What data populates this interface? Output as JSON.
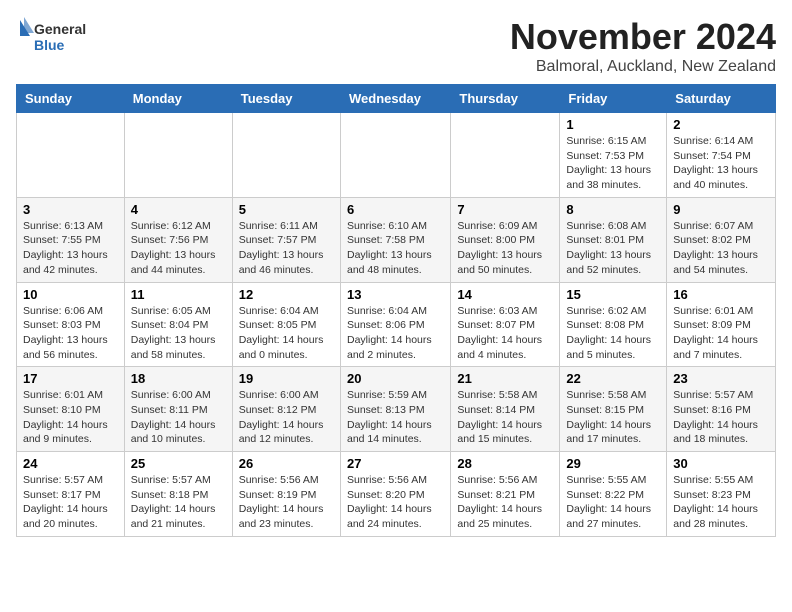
{
  "logo": {
    "general": "General",
    "blue": "Blue"
  },
  "header": {
    "title": "November 2024",
    "subtitle": "Balmoral, Auckland, New Zealand"
  },
  "weekdays": [
    "Sunday",
    "Monday",
    "Tuesday",
    "Wednesday",
    "Thursday",
    "Friday",
    "Saturday"
  ],
  "weeks": [
    [
      {
        "day": "",
        "info": ""
      },
      {
        "day": "",
        "info": ""
      },
      {
        "day": "",
        "info": ""
      },
      {
        "day": "",
        "info": ""
      },
      {
        "day": "",
        "info": ""
      },
      {
        "day": "1",
        "info": "Sunrise: 6:15 AM\nSunset: 7:53 PM\nDaylight: 13 hours and 38 minutes."
      },
      {
        "day": "2",
        "info": "Sunrise: 6:14 AM\nSunset: 7:54 PM\nDaylight: 13 hours and 40 minutes."
      }
    ],
    [
      {
        "day": "3",
        "info": "Sunrise: 6:13 AM\nSunset: 7:55 PM\nDaylight: 13 hours and 42 minutes."
      },
      {
        "day": "4",
        "info": "Sunrise: 6:12 AM\nSunset: 7:56 PM\nDaylight: 13 hours and 44 minutes."
      },
      {
        "day": "5",
        "info": "Sunrise: 6:11 AM\nSunset: 7:57 PM\nDaylight: 13 hours and 46 minutes."
      },
      {
        "day": "6",
        "info": "Sunrise: 6:10 AM\nSunset: 7:58 PM\nDaylight: 13 hours and 48 minutes."
      },
      {
        "day": "7",
        "info": "Sunrise: 6:09 AM\nSunset: 8:00 PM\nDaylight: 13 hours and 50 minutes."
      },
      {
        "day": "8",
        "info": "Sunrise: 6:08 AM\nSunset: 8:01 PM\nDaylight: 13 hours and 52 minutes."
      },
      {
        "day": "9",
        "info": "Sunrise: 6:07 AM\nSunset: 8:02 PM\nDaylight: 13 hours and 54 minutes."
      }
    ],
    [
      {
        "day": "10",
        "info": "Sunrise: 6:06 AM\nSunset: 8:03 PM\nDaylight: 13 hours and 56 minutes."
      },
      {
        "day": "11",
        "info": "Sunrise: 6:05 AM\nSunset: 8:04 PM\nDaylight: 13 hours and 58 minutes."
      },
      {
        "day": "12",
        "info": "Sunrise: 6:04 AM\nSunset: 8:05 PM\nDaylight: 14 hours and 0 minutes."
      },
      {
        "day": "13",
        "info": "Sunrise: 6:04 AM\nSunset: 8:06 PM\nDaylight: 14 hours and 2 minutes."
      },
      {
        "day": "14",
        "info": "Sunrise: 6:03 AM\nSunset: 8:07 PM\nDaylight: 14 hours and 4 minutes."
      },
      {
        "day": "15",
        "info": "Sunrise: 6:02 AM\nSunset: 8:08 PM\nDaylight: 14 hours and 5 minutes."
      },
      {
        "day": "16",
        "info": "Sunrise: 6:01 AM\nSunset: 8:09 PM\nDaylight: 14 hours and 7 minutes."
      }
    ],
    [
      {
        "day": "17",
        "info": "Sunrise: 6:01 AM\nSunset: 8:10 PM\nDaylight: 14 hours and 9 minutes."
      },
      {
        "day": "18",
        "info": "Sunrise: 6:00 AM\nSunset: 8:11 PM\nDaylight: 14 hours and 10 minutes."
      },
      {
        "day": "19",
        "info": "Sunrise: 6:00 AM\nSunset: 8:12 PM\nDaylight: 14 hours and 12 minutes."
      },
      {
        "day": "20",
        "info": "Sunrise: 5:59 AM\nSunset: 8:13 PM\nDaylight: 14 hours and 14 minutes."
      },
      {
        "day": "21",
        "info": "Sunrise: 5:58 AM\nSunset: 8:14 PM\nDaylight: 14 hours and 15 minutes."
      },
      {
        "day": "22",
        "info": "Sunrise: 5:58 AM\nSunset: 8:15 PM\nDaylight: 14 hours and 17 minutes."
      },
      {
        "day": "23",
        "info": "Sunrise: 5:57 AM\nSunset: 8:16 PM\nDaylight: 14 hours and 18 minutes."
      }
    ],
    [
      {
        "day": "24",
        "info": "Sunrise: 5:57 AM\nSunset: 8:17 PM\nDaylight: 14 hours and 20 minutes."
      },
      {
        "day": "25",
        "info": "Sunrise: 5:57 AM\nSunset: 8:18 PM\nDaylight: 14 hours and 21 minutes."
      },
      {
        "day": "26",
        "info": "Sunrise: 5:56 AM\nSunset: 8:19 PM\nDaylight: 14 hours and 23 minutes."
      },
      {
        "day": "27",
        "info": "Sunrise: 5:56 AM\nSunset: 8:20 PM\nDaylight: 14 hours and 24 minutes."
      },
      {
        "day": "28",
        "info": "Sunrise: 5:56 AM\nSunset: 8:21 PM\nDaylight: 14 hours and 25 minutes."
      },
      {
        "day": "29",
        "info": "Sunrise: 5:55 AM\nSunset: 8:22 PM\nDaylight: 14 hours and 27 minutes."
      },
      {
        "day": "30",
        "info": "Sunrise: 5:55 AM\nSunset: 8:23 PM\nDaylight: 14 hours and 28 minutes."
      }
    ]
  ]
}
